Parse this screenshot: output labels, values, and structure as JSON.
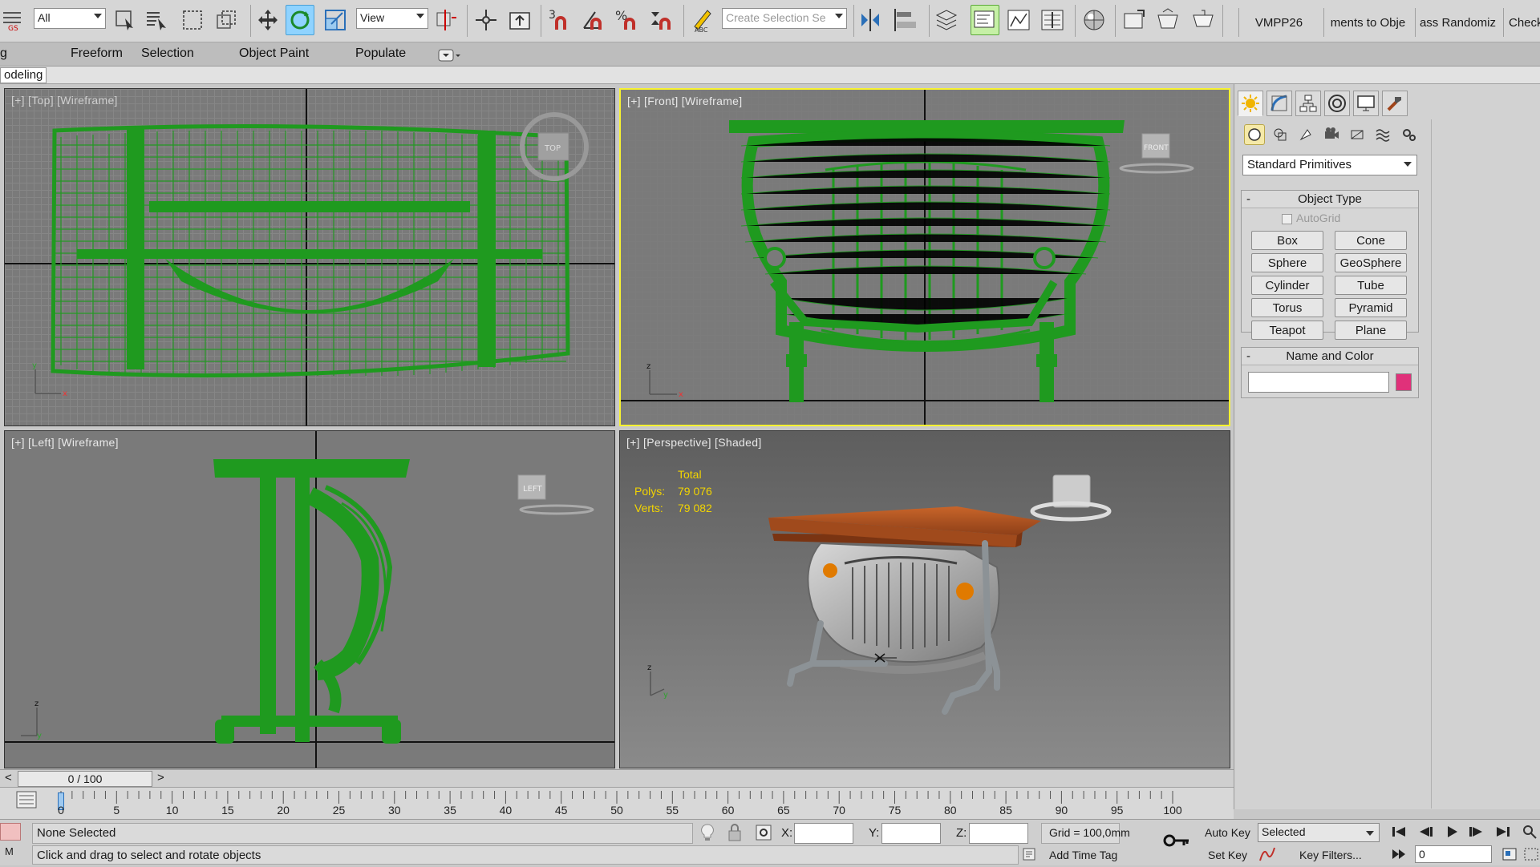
{
  "toolbar": {
    "selection_filter": "All",
    "ref_coord": "View",
    "snap_value": "3",
    "named_selection_placeholder": "Create Selection Se",
    "custom_buttons": [
      "VMPP26",
      "ments to Obje",
      "ass Randomiz",
      "Check"
    ]
  },
  "ribbon": {
    "tabs": [
      "Freeform",
      "Selection",
      "Object Paint",
      "Populate"
    ],
    "first_tab_fragment": "g",
    "sub_label": "odeling"
  },
  "viewports": {
    "top": {
      "label": "[+] [Top] [Wireframe]",
      "cube_text": "TOP"
    },
    "front": {
      "label": "[+] [Front] [Wireframe]",
      "cube_text": "FRONT"
    },
    "left": {
      "label": "[+] [Left] [Wireframe]",
      "cube_text": "LEFT"
    },
    "perspective": {
      "label": "[+] [Perspective] [Shaded]",
      "stats_title": "Total",
      "polys_label": "Polys:",
      "polys_value": "79 076",
      "verts_label": "Verts:",
      "verts_value": "79 082"
    },
    "wire_color": "#1f9a1f",
    "active_border": "#f7f230"
  },
  "command_panel": {
    "category": "Standard Primitives",
    "object_type_title": "Object Type",
    "autogrid_label": "AutoGrid",
    "primitives": [
      "Box",
      "Cone",
      "Sphere",
      "GeoSphere",
      "Cylinder",
      "Tube",
      "Torus",
      "Pyramid",
      "Teapot",
      "Plane"
    ],
    "name_color_title": "Name and Color",
    "object_color": "#e0317a"
  },
  "timeslider": {
    "value": "0 / 100",
    "prev": "<",
    "next": ">"
  },
  "trackbar": {
    "labels": [
      "0",
      "5",
      "10",
      "15",
      "20",
      "25",
      "30",
      "35",
      "40",
      "45",
      "50",
      "55",
      "60",
      "65",
      "70",
      "75",
      "80",
      "85",
      "90",
      "95",
      "100"
    ]
  },
  "status": {
    "selection": "None Selected",
    "prompt": "Click and drag to select and rotate objects",
    "x_label": "X:",
    "y_label": "Y:",
    "z_label": "Z:",
    "grid": "Grid = 100,0mm",
    "add_time_tag": "Add Time Tag",
    "auto_key": "Auto Key",
    "set_key": "Set Key",
    "key_mode": "Selected",
    "key_filters": "Key Filters...",
    "current_frame": "0",
    "script_label": "M"
  }
}
